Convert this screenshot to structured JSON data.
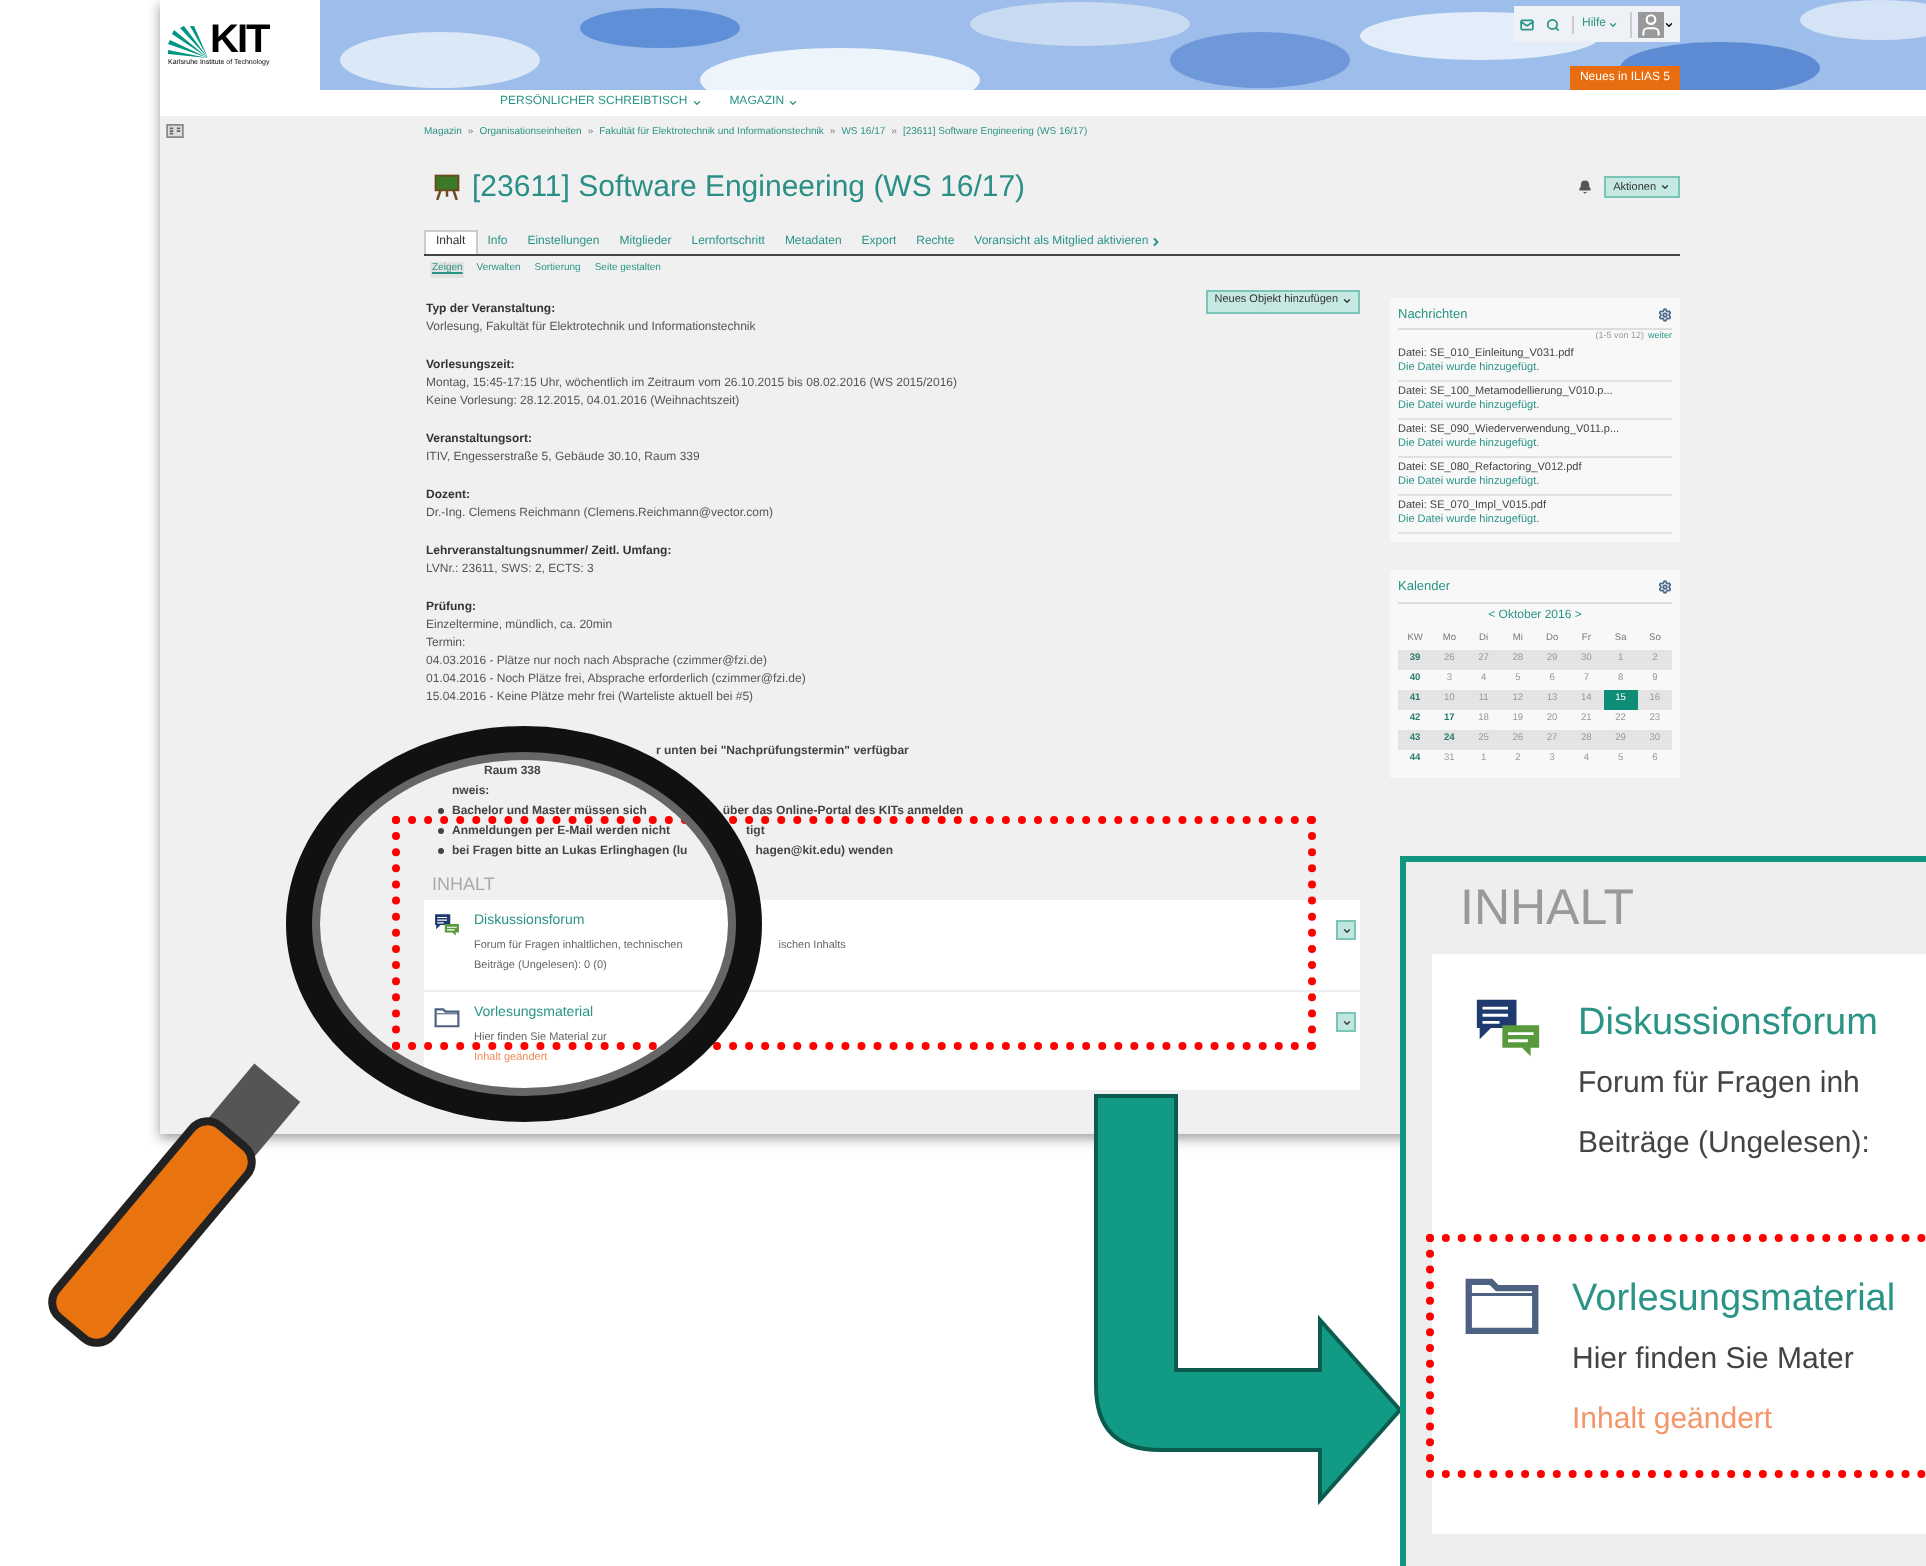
{
  "logo": {
    "mark": "KIT",
    "subtitle": "Karlsruhe Institute of Technology"
  },
  "header": {
    "help": "Hilfe",
    "news_button": "Neues in ILIAS 5"
  },
  "nav": [
    "PERSÖNLICHER SCHREIBTISCH",
    "MAGAZIN"
  ],
  "breadcrumb": {
    "separator": "»",
    "items": [
      "Magazin",
      "Organisationseinheiten",
      "Fakultät für Elektrotechnik und Informationstechnik",
      "WS 16/17",
      "[23611] Software Engineering (WS 16/17)"
    ]
  },
  "title": "[23611] Software Engineering (WS 16/17)",
  "actions_button": "Aktionen",
  "tabs": [
    {
      "label": "Inhalt",
      "selected": true
    },
    {
      "label": "Info",
      "selected": false
    },
    {
      "label": "Einstellungen",
      "selected": false
    },
    {
      "label": "Mitglieder",
      "selected": false
    },
    {
      "label": "Lernfortschritt",
      "selected": false
    },
    {
      "label": "Metadaten",
      "selected": false
    },
    {
      "label": "Export",
      "selected": false
    },
    {
      "label": "Rechte",
      "selected": false
    },
    {
      "label": "Voransicht als Mitglied aktivieren",
      "selected": false
    }
  ],
  "subtabs": [
    {
      "label": "Zeigen",
      "selected": true
    },
    {
      "label": "Verwalten",
      "selected": false
    },
    {
      "label": "Sortierung",
      "selected": false
    },
    {
      "label": "Seite gestalten",
      "selected": false
    }
  ],
  "add_button": "Neues Objekt hinzufügen",
  "info": [
    {
      "heading": "Typ der Veranstaltung:",
      "lines": [
        "Vorlesung, Fakultät für Elektrotechnik und Informationstechnik"
      ]
    },
    {
      "heading": "Vorlesungszeit:",
      "lines": [
        "Montag, 15:45-17:15 Uhr, wöchentlich im Zeitraum vom 26.10.2015 bis 08.02.2016 (WS 2015/2016)",
        "Keine Vorlesung: 28.12.2015, 04.01.2016 (Weihnachtszeit)"
      ]
    },
    {
      "heading": "Veranstaltungsort:",
      "lines": [
        "ITIV, Engesserstraße 5, Gebäude 30.10, Raum 339"
      ]
    },
    {
      "heading": "Dozent:",
      "lines": [
        "Dr.-Ing. Clemens Reichmann (Clemens.Reichmann@vector.com)"
      ]
    },
    {
      "heading": "Lehrveranstaltungsnummer/ Zeitl. Umfang:",
      "lines": [
        "LVNr.: 23611, SWS: 2, ECTS: 3"
      ]
    },
    {
      "heading": "Prüfung:",
      "lines": [
        "Einzeltermine, mündlich, ca. 20min",
        "Termin:",
        "04.03.2016 - Plätze nur noch nach Absprache (czimmer@fzi.de)",
        "01.04.2016 - Noch Plätze frei, Absprache erforderlich (czimmer@fzi.de)",
        "15.04.2016 - Keine Plätze mehr frei (Warteliste aktuell bei #5)"
      ]
    }
  ],
  "notes": [
    {
      "kind": "text",
      "segments": [
        "r unten bei \"Nachprüfungstermin\" verfügbar"
      ]
    },
    {
      "kind": "text",
      "segments": [
        "Raum 338"
      ]
    },
    {
      "kind": "text",
      "segments": [
        "nweis:"
      ]
    },
    {
      "kind": "bullet",
      "segments": [
        "Bachelor und Master müssen sich",
        "über das Online-Portal des KITs anmelden"
      ]
    },
    {
      "kind": "bullet",
      "segments": [
        "Anmeldungen per E-Mail werden nicht",
        "tigt"
      ]
    },
    {
      "kind": "bullet",
      "segments": [
        "bei Fragen bitte an Lukas Erlinghagen (lu",
        "hagen@kit.edu) wenden"
      ]
    }
  ],
  "content": {
    "heading": "INHALT",
    "items": [
      {
        "kind": "forum",
        "title": "Diskussionsforum",
        "lines": [
          {
            "kind": "text",
            "segments": [
              "Forum für Fragen inhaltlichen, technischen",
              "ischen Inhalts"
            ]
          },
          {
            "kind": "text",
            "segments": [
              "Beiträge (Ungelesen): 0 (0)"
            ]
          }
        ]
      },
      {
        "kind": "folder",
        "title": "Vorlesungsmaterial",
        "lines": [
          {
            "kind": "text",
            "segments": [
              "Hier finden Sie Material zur"
            ]
          },
          {
            "kind": "changed",
            "segments": [
              "Inhalt geändert"
            ]
          }
        ]
      }
    ]
  },
  "news": {
    "title": "Nachrichten",
    "range": "(1-5 von 12)",
    "more": "weiter",
    "items": [
      {
        "file": "Datei: SE_010_Einleitung_V031.pdf",
        "note": "Die Datei wurde hinzugefügt."
      },
      {
        "file": "Datei: SE_100_Metamodellierung_V010.p...",
        "note": "Die Datei wurde hinzugefügt."
      },
      {
        "file": "Datei: SE_090_Wiederverwendung_V011.p...",
        "note": "Die Datei wurde hinzugefügt."
      },
      {
        "file": "Datei: SE_080_Refactoring_V012.pdf",
        "note": "Die Datei wurde hinzugefügt."
      },
      {
        "file": "Datei: SE_070_Impl_V015.pdf",
        "note": "Die Datei wurde hinzugefügt."
      }
    ]
  },
  "calendar": {
    "title": "Kalender",
    "month": "< Oktober 2016 >",
    "weekdays": [
      "KW",
      "Mo",
      "Di",
      "Mi",
      "Do",
      "Fr",
      "Sa",
      "So"
    ],
    "rows": [
      {
        "kw": "39",
        "days": [
          {
            "label": "26",
            "selected": false,
            "marked": false
          },
          {
            "label": "27",
            "selected": false,
            "marked": false
          },
          {
            "label": "28",
            "selected": false,
            "marked": false
          },
          {
            "label": "29",
            "selected": false,
            "marked": false
          },
          {
            "label": "30",
            "selected": false,
            "marked": false
          },
          {
            "label": "1",
            "selected": false,
            "marked": false
          },
          {
            "label": "2",
            "selected": false,
            "marked": false
          }
        ]
      },
      {
        "kw": "40",
        "days": [
          {
            "label": "3",
            "selected": false,
            "marked": false
          },
          {
            "label": "4",
            "selected": false,
            "marked": false
          },
          {
            "label": "5",
            "selected": false,
            "marked": false
          },
          {
            "label": "6",
            "selected": false,
            "marked": false
          },
          {
            "label": "7",
            "selected": false,
            "marked": false
          },
          {
            "label": "8",
            "selected": false,
            "marked": false
          },
          {
            "label": "9",
            "selected": false,
            "marked": false
          }
        ]
      },
      {
        "kw": "41",
        "days": [
          {
            "label": "10",
            "selected": false,
            "marked": false
          },
          {
            "label": "11",
            "selected": false,
            "marked": false
          },
          {
            "label": "12",
            "selected": false,
            "marked": false
          },
          {
            "label": "13",
            "selected": false,
            "marked": false
          },
          {
            "label": "14",
            "selected": false,
            "marked": false
          },
          {
            "label": "15",
            "selected": true,
            "marked": false
          },
          {
            "label": "16",
            "selected": false,
            "marked": false
          }
        ]
      },
      {
        "kw": "42",
        "days": [
          {
            "label": "17",
            "selected": false,
            "marked": true
          },
          {
            "label": "18",
            "selected": false,
            "marked": false
          },
          {
            "label": "19",
            "selected": false,
            "marked": false
          },
          {
            "label": "20",
            "selected": false,
            "marked": false
          },
          {
            "label": "21",
            "selected": false,
            "marked": false
          },
          {
            "label": "22",
            "selected": false,
            "marked": false
          },
          {
            "label": "23",
            "selected": false,
            "marked": false
          }
        ]
      },
      {
        "kw": "43",
        "days": [
          {
            "label": "24",
            "selected": false,
            "marked": true
          },
          {
            "label": "25",
            "selected": false,
            "marked": false
          },
          {
            "label": "26",
            "selected": false,
            "marked": false
          },
          {
            "label": "27",
            "selected": false,
            "marked": false
          },
          {
            "label": "28",
            "selected": false,
            "marked": false
          },
          {
            "label": "29",
            "selected": false,
            "marked": false
          },
          {
            "label": "30",
            "selected": false,
            "marked": false
          }
        ]
      },
      {
        "kw": "44",
        "days": [
          {
            "label": "31",
            "selected": false,
            "marked": false
          },
          {
            "label": "1",
            "selected": false,
            "marked": false
          },
          {
            "label": "2",
            "selected": false,
            "marked": false
          },
          {
            "label": "3",
            "selected": false,
            "marked": false
          },
          {
            "label": "4",
            "selected": false,
            "marked": false
          },
          {
            "label": "5",
            "selected": false,
            "marked": false
          },
          {
            "label": "6",
            "selected": false,
            "marked": false
          }
        ]
      }
    ]
  },
  "inset": {
    "heading": "INHALT",
    "items": [
      {
        "kind": "forum",
        "title": "Diskussionsforum",
        "lines": [
          {
            "kind": "text",
            "text": "Forum für Fragen inh"
          },
          {
            "kind": "text",
            "text": "Beiträge (Ungelesen):"
          }
        ]
      },
      {
        "kind": "folder",
        "title": "Vorlesungsmaterial",
        "lines": [
          {
            "kind": "text",
            "text": "Hier finden Sie Mater"
          },
          {
            "kind": "changed",
            "text": "Inhalt geändert"
          }
        ]
      }
    ]
  }
}
